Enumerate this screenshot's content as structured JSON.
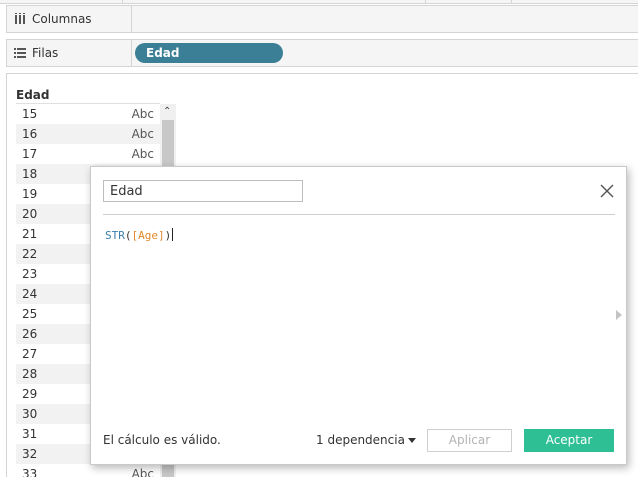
{
  "shelves": {
    "columns": {
      "label": "Columnas",
      "icon": "columns-icon"
    },
    "rows": {
      "label": "Filas",
      "icon": "rows-icon",
      "pill": "Edad"
    }
  },
  "table": {
    "header": "Edad",
    "rows": [
      {
        "value": "15",
        "type": "Abc"
      },
      {
        "value": "16",
        "type": "Abc"
      },
      {
        "value": "17",
        "type": "Abc"
      },
      {
        "value": "18",
        "type": ""
      },
      {
        "value": "19",
        "type": ""
      },
      {
        "value": "20",
        "type": ""
      },
      {
        "value": "21",
        "type": ""
      },
      {
        "value": "22",
        "type": ""
      },
      {
        "value": "23",
        "type": ""
      },
      {
        "value": "24",
        "type": ""
      },
      {
        "value": "25",
        "type": ""
      },
      {
        "value": "26",
        "type": ""
      },
      {
        "value": "27",
        "type": ""
      },
      {
        "value": "28",
        "type": ""
      },
      {
        "value": "29",
        "type": ""
      },
      {
        "value": "30",
        "type": ""
      },
      {
        "value": "31",
        "type": ""
      },
      {
        "value": "32",
        "type": ""
      },
      {
        "value": "33",
        "type": "Abc"
      }
    ]
  },
  "dialog": {
    "name_value": "Edad",
    "formula": {
      "function": "STR",
      "open": "(",
      "field": "[Age]",
      "close": ")"
    },
    "status": "El cálculo es válido.",
    "dependencies": "1 dependencia",
    "apply_label": "Aplicar",
    "ok_label": "Aceptar"
  },
  "colors": {
    "pill": "#3b7f96",
    "ok_button": "#2fbf95",
    "formula_function": "#3a7fa8",
    "formula_field": "#e08a2c"
  }
}
